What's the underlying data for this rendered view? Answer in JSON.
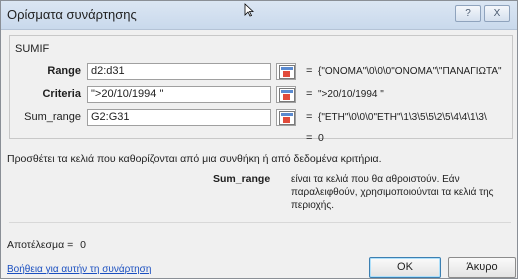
{
  "dialog": {
    "title": "Ορίσματα συνάρτησης",
    "help_button": "?",
    "close_button": "X"
  },
  "function": {
    "name": "SUMIF",
    "args": [
      {
        "label": "Range",
        "value": "d2:d31",
        "result": "{\"ONOMA\"\\0\\0\\0\"ONOMA\"\\\"ΠΑΝΑΓΙΩΤΑ\"",
        "bold": true
      },
      {
        "label": "Criteria",
        "value": "\">20/10/1994 \"",
        "result": "\">20/10/1994 \"",
        "bold": true
      },
      {
        "label": "Sum_range",
        "value": "G2:G31",
        "result": "{\"ETH\"\\0\\0\\0\"ETH\"\\1\\3\\5\\5\\2\\5\\4\\4\\1\\3\\",
        "bold": false
      }
    ],
    "equals_sign": "=",
    "result_value": "0"
  },
  "description": "Προσθέτει τα κελιά που καθορίζονται από μια συνθήκη ή από δεδομένα κριτήρια.",
  "param_help": {
    "name": "Sum_range",
    "text": "είναι τα κελιά που θα αθροιστούν. Εάν παραλειφθούν, χρησιμοποιούνται τα κελιά της περιοχής."
  },
  "formula_result": {
    "label": "Αποτέλεσμα =",
    "value": "0"
  },
  "footer": {
    "help_link": "Βοήθεια για αυτήν τη συνάρτηση",
    "ok_label": "OK",
    "cancel_label": "Άκυρο"
  },
  "colors": {
    "link": "#1a4fc0",
    "titlebar": "#c9d9ec"
  },
  "icons": {
    "ref_button": "collapse-dialog-icon"
  }
}
